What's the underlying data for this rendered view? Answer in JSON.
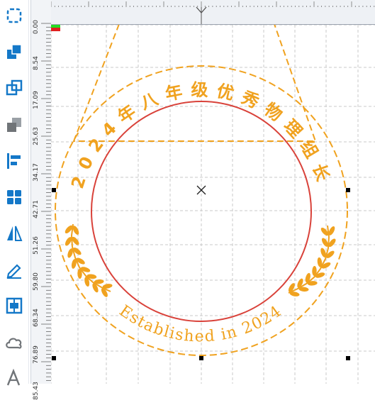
{
  "toolbar": {
    "tools": [
      {
        "name": "select-frame-icon"
      },
      {
        "name": "bring-forward-icon"
      },
      {
        "name": "duplicate-icon"
      },
      {
        "name": "send-backward-icon"
      },
      {
        "name": "align-left-icon"
      },
      {
        "name": "grid-layout-icon"
      },
      {
        "name": "flip-icon"
      },
      {
        "name": "edit-pen-icon"
      },
      {
        "name": "distribute-icon"
      },
      {
        "name": "cloud-shape-icon"
      },
      {
        "name": "text-style-icon"
      }
    ]
  },
  "ruler": {
    "vertical_labels": [
      "0.00",
      "8.54",
      "17.09",
      "25.63",
      "34.17",
      "42.71",
      "51.26",
      "59.80",
      "68.34",
      "76.89",
      "85.43"
    ]
  },
  "stamp": {
    "top_text": "2024年八年级优秀物理组长",
    "bottom_text": "Established in 2024",
    "stroke_color": "#f0a21f",
    "inner_circle_color": "#d9423a"
  },
  "colors": {
    "grid": "#c9c9c9",
    "handle": "#000000",
    "indicator_green": "#22dd22",
    "indicator_red": "#e02020"
  }
}
